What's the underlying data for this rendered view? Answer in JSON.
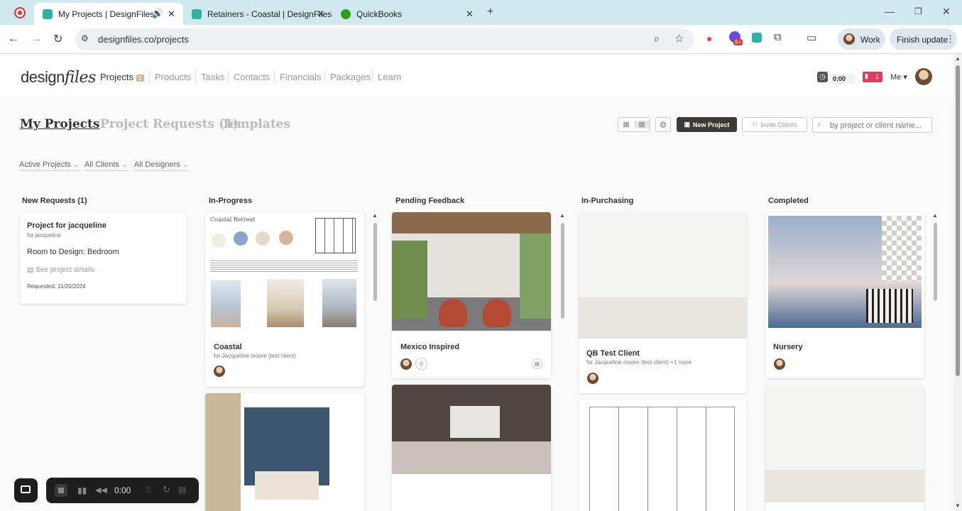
{
  "browser": {
    "tabs": [
      {
        "title": "My Projects | DesignFiles"
      },
      {
        "title": "Retainers - Coastal | DesignFiles"
      },
      {
        "title": "QuickBooks"
      }
    ],
    "url": "designfiles.co/projects",
    "profile": "Work",
    "update_label": "Finish update",
    "ext_badge": "9+"
  },
  "app": {
    "logo_a": "design",
    "logo_b": "files",
    "nav": [
      {
        "label": "Projects",
        "badge": "1"
      },
      {
        "label": "Products"
      },
      {
        "label": "Tasks"
      },
      {
        "label": "Contacts"
      },
      {
        "label": "Financials"
      },
      {
        "label": "Packages"
      },
      {
        "label": "Learn"
      }
    ],
    "timer": "0:00",
    "notif": "1",
    "me": "Me"
  },
  "page": {
    "tabs": [
      "My Projects",
      "Project Requests (1)",
      "Templates"
    ],
    "new_project": "New Project",
    "invite_clients": "Invite Clients",
    "search_placeholder": "by project or client name...",
    "filters": [
      "Active Projects",
      "All Clients",
      "All Designers"
    ]
  },
  "columns": [
    {
      "title": "New Requests (1)"
    },
    {
      "title": "In-Progress"
    },
    {
      "title": "Pending Feedback"
    },
    {
      "title": "In-Purchasing"
    },
    {
      "title": "Completed"
    }
  ],
  "request_card": {
    "title": "Project for jacqueline",
    "client": "for jacqueline",
    "room": "Room to Design: Bedroom",
    "details": "See project details",
    "requested": "Requested: 11/20/2024"
  },
  "project_cards": {
    "coastal": {
      "title": "Coastal",
      "client": "for Jacqueline moore (test client)",
      "board_title": "Coastal Retreat"
    },
    "mexico": {
      "title": "Mexico Inspired"
    },
    "qb": {
      "title": "QB Test Client",
      "client": "for Jacqueline moore (test client) +1 more"
    },
    "nursery": {
      "title": "Nursery"
    }
  },
  "recorder": {
    "time": "0:00"
  },
  "colors": {
    "primary_dark": "#3b3a36",
    "accent_red": "#e23b5b",
    "tab_bar": "#cfe9ef"
  }
}
